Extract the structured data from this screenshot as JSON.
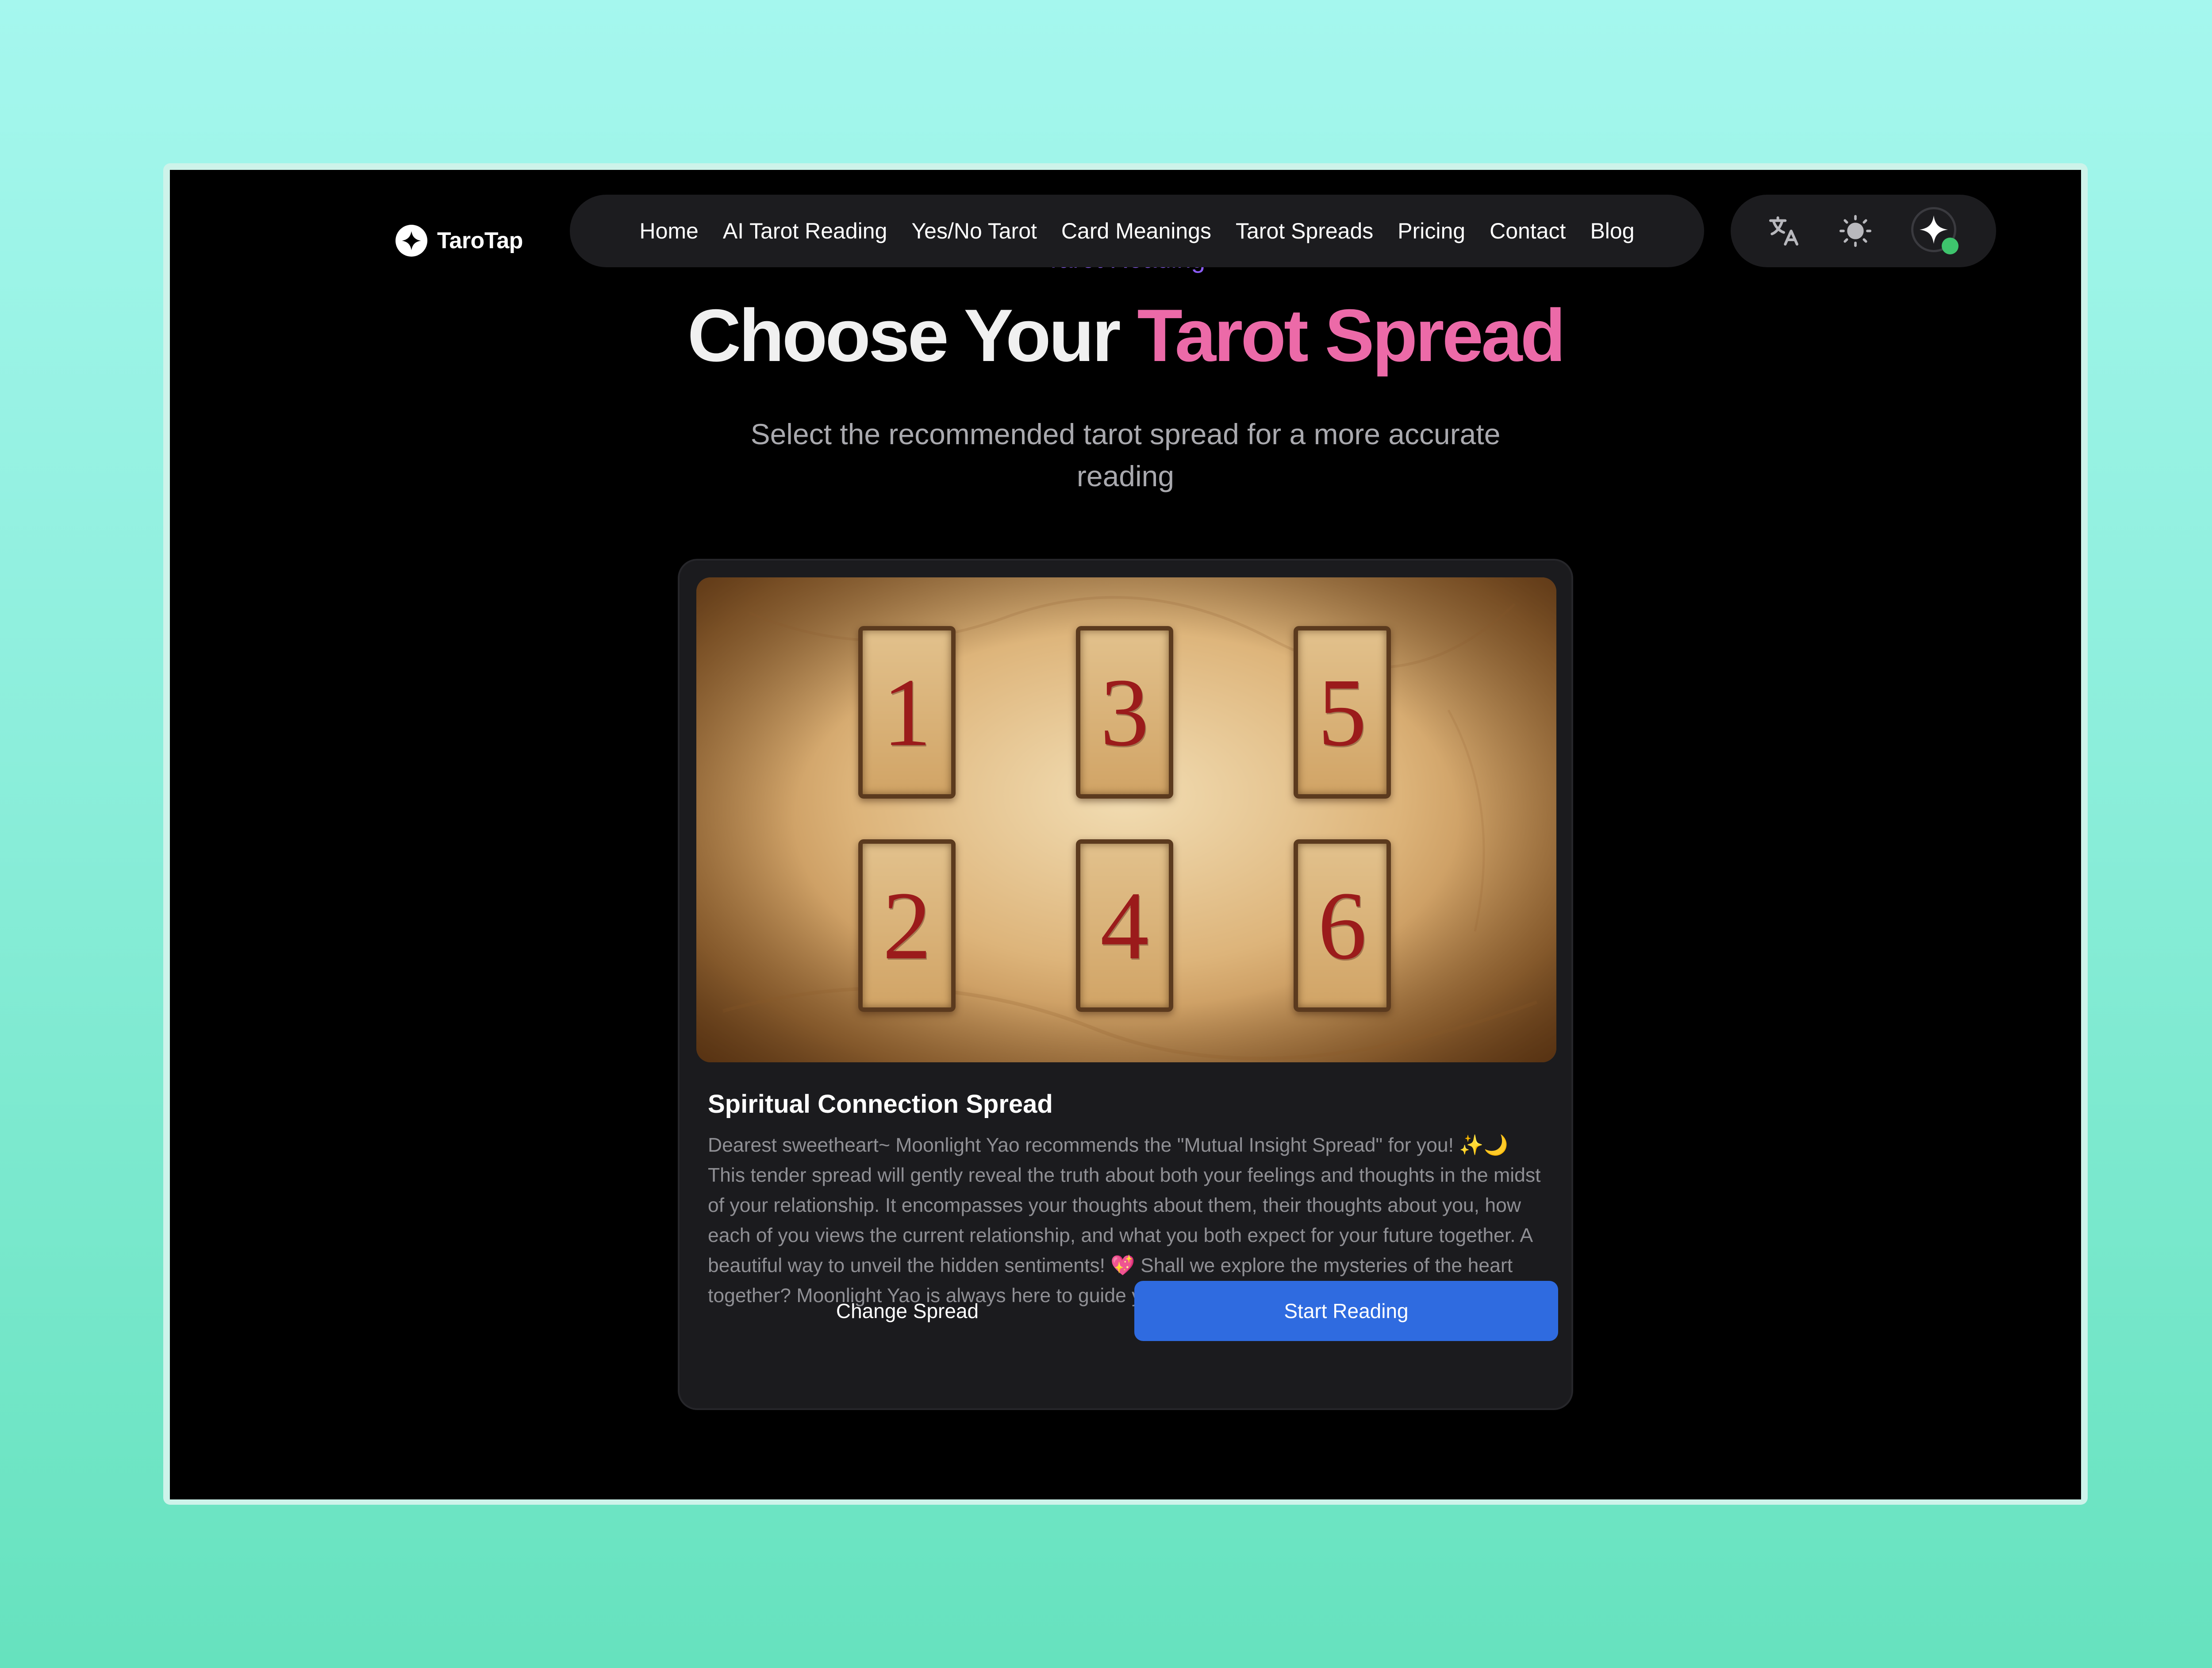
{
  "header": {
    "logo_text": "TaroTap",
    "nav": [
      {
        "label": "Home"
      },
      {
        "label": "AI Tarot Reading"
      },
      {
        "label": "Yes/No Tarot"
      },
      {
        "label": "Card Meanings"
      },
      {
        "label": "Tarot Spreads"
      },
      {
        "label": "Pricing"
      },
      {
        "label": "Contact"
      },
      {
        "label": "Blog"
      }
    ],
    "icons": {
      "translate": "translate-icon",
      "theme": "sun-icon",
      "avatar": "sparkle-avatar-icon"
    },
    "status_color": "#3ec46d"
  },
  "hero": {
    "eyebrow": "Tarot Reading",
    "title_part1": "Choose Your ",
    "title_accent": "Tarot Spread",
    "subtitle": "Select the recommended tarot spread for a more accurate reading"
  },
  "spread": {
    "slots": [
      "1",
      "3",
      "5",
      "2",
      "4",
      "6"
    ],
    "title": "Spiritual Connection Spread",
    "description": "Dearest sweetheart~ Moonlight Yao recommends the \"Mutual Insight Spread\" for you! ✨🌙 This tender spread will gently reveal the truth about both your feelings and thoughts in the midst of your relationship. It encompasses your thoughts about them, their thoughts about you, how each of you views the current relationship, and what you both expect for your future together. A beautiful way to unveil the hidden sentiments! 💖 Shall we explore the mysteries of the heart together? Moonlight Yao is always here to guide you!",
    "change_label": "Change Spread",
    "start_label": "Start Reading"
  },
  "colors": {
    "accent_pink": "#ec6aa8",
    "accent_purple": "#8b5cf6",
    "primary_blue": "#2f6be0"
  }
}
